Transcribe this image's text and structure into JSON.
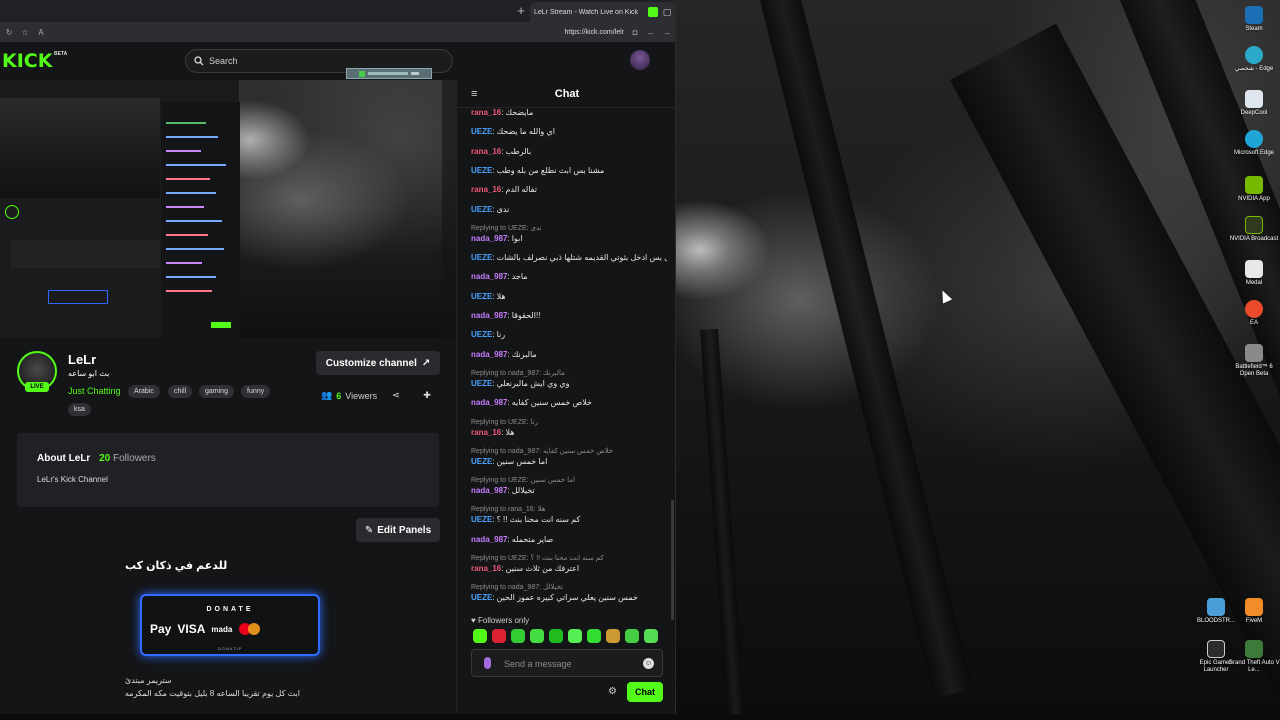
{
  "browser": {
    "tab_title": "LeLr Stream - Watch Live on Kick",
    "url": "https://kick.com/lelr"
  },
  "header": {
    "logo": "KICK",
    "logo_badge": "BETA",
    "search_placeholder": "Search"
  },
  "channel": {
    "name": "LeLr",
    "stream_title": "بث ابو ساعه",
    "live_label": "LIVE",
    "category": "Just Chatting",
    "tags": [
      "Arabic",
      "chill",
      "gaming",
      "funny",
      "ksa"
    ],
    "customize_label": "Customize channel",
    "viewers_count": "6",
    "viewers_label": "Viewers"
  },
  "about": {
    "title": "About LeLr",
    "followers_count": "20",
    "followers_label": "Followers",
    "description": "LeLr's Kick Channel",
    "edit_panels_label": "Edit Panels"
  },
  "panel": {
    "title": "للدعم في ذكان كب",
    "donate_label": "DONATE",
    "payments": [
      "Pay",
      "VISA",
      "mada"
    ],
    "donate_footer": "DONATIP",
    "line1": "ستريمر مبتدئ",
    "line2": "ابث كل يوم تقريبا الساعه 8 بليل بتوقيت مكه المكرمه"
  },
  "chat": {
    "title": "Chat",
    "messages": [
      {
        "reply": "",
        "user": "rana_16",
        "text": "مايضحك",
        "color": "#f05a78"
      },
      {
        "reply": "",
        "user": "UEZE",
        "text": "اي والله ما يضحك",
        "color": "#4aa3ff"
      },
      {
        "reply": "",
        "user": "rana_16",
        "text": "بالرطب",
        "color": "#f05a78"
      },
      {
        "reply": "",
        "user": "UEZE",
        "text": "مشنا بس ابث نطلع من بله وطب",
        "color": "#4aa3ff"
      },
      {
        "reply": "",
        "user": "rana_16",
        "text": "تفاله الدم",
        "color": "#f05a78"
      },
      {
        "reply": "",
        "user": "UEZE",
        "text": "ندى",
        "color": "#4aa3ff"
      },
      {
        "reply": "Replying to UEZE: ندى",
        "user": "nada_987",
        "text": "ابوا",
        "color": "#c77dff"
      },
      {
        "reply": "",
        "user": "UEZE",
        "text": "اقول بس ادخل بثوتي القديمه شتلها ذبي نصرلف بالشات",
        "color": "#4aa3ff"
      },
      {
        "reply": "",
        "user": "nada_987",
        "text": "ماجد",
        "color": "#c77dff"
      },
      {
        "reply": "",
        "user": "UEZE",
        "text": "هلا",
        "color": "#4aa3ff"
      },
      {
        "reply": "",
        "user": "nada_987",
        "text": "الحقوقا!!",
        "color": "#c77dff"
      },
      {
        "reply": "",
        "user": "UEZE",
        "text": "رنا",
        "color": "#4aa3ff"
      },
      {
        "reply": "",
        "user": "nada_987",
        "text": "مالبرنك",
        "color": "#c77dff"
      },
      {
        "reply": "Replying to nada_987: مالبرنك",
        "user": "UEZE",
        "text": "وي وي ايش مالبرنعلي",
        "color": "#4aa3ff"
      },
      {
        "reply": "",
        "user": "nada_987",
        "text": "خلاص خمس سنين كفايه",
        "color": "#c77dff"
      },
      {
        "reply": "Replying to UEZE: رنا",
        "user": "rana_16",
        "text": "هلا",
        "color": "#f05a78"
      },
      {
        "reply": "Replying to nada_987: خلاص خمس سنين كفايه",
        "user": "UEZE",
        "text": "اما خمس سنين",
        "color": "#4aa3ff"
      },
      {
        "reply": "Replying to UEZE: اما خمس سنين",
        "user": "nada_987",
        "text": "تخيلالل",
        "color": "#c77dff"
      },
      {
        "reply": "Replying to rana_16: هلا",
        "user": "UEZE",
        "text": "كم سنه انت محنا بنث !! ؟",
        "color": "#4aa3ff"
      },
      {
        "reply": "",
        "user": "nada_987",
        "text": "صاير متحمله",
        "color": "#c77dff"
      },
      {
        "reply": "Replying to UEZE: كم سنه انت محنا بنث !! ؟",
        "user": "rana_16",
        "text": "اعترفك من ثلاث سنين",
        "color": "#f05a78"
      },
      {
        "reply": "Replying to nada_987: تخيلالل",
        "user": "UEZE",
        "text": "خمس سنين يعلي سراتي كبيره عموز الحين",
        "color": "#4aa3ff"
      }
    ],
    "followers_only_label": "Followers only",
    "input_placeholder": "Send a message",
    "send_label": "Chat"
  },
  "desktop_icons": [
    {
      "label": "Steam",
      "icon": "steam-icon",
      "color": "#1b6fb5"
    },
    {
      "label": "شخصي - Edge",
      "icon": "edge-icon",
      "color": "#2aa9c8"
    },
    {
      "label": "DeepCool",
      "icon": "deepcool-icon",
      "color": "#dfe6ee"
    },
    {
      "label": "Microsoft Edge",
      "icon": "edge-icon",
      "color": "#1fa5d6"
    },
    {
      "label": "NVIDIA App",
      "icon": "nvidia-icon",
      "color": "#76b900"
    },
    {
      "label": "NVIDIA Broadcast",
      "icon": "nvidia-broadcast-icon",
      "color": "#2f3a1c"
    },
    {
      "label": "Medal",
      "icon": "medal-icon",
      "color": "#e8e8e8"
    },
    {
      "label": "EA",
      "icon": "ea-icon",
      "color": "#e94b2c"
    },
    {
      "label": "Battlefield™ 6 Open Beta",
      "icon": "battlefield-icon",
      "color": "#8a8a8a"
    },
    {
      "label": "BLOODSTR...",
      "icon": "bloodstrike-icon",
      "color": "#4a9fd8"
    },
    {
      "label": "FiveM",
      "icon": "fivem-icon",
      "color": "#f28c28"
    },
    {
      "label": "Epic Games Launcher",
      "icon": "epic-icon",
      "color": "#2b2b2b"
    },
    {
      "label": "Grand Theft Auto V Le...",
      "icon": "gta-icon",
      "color": "#3d7a3a"
    }
  ]
}
